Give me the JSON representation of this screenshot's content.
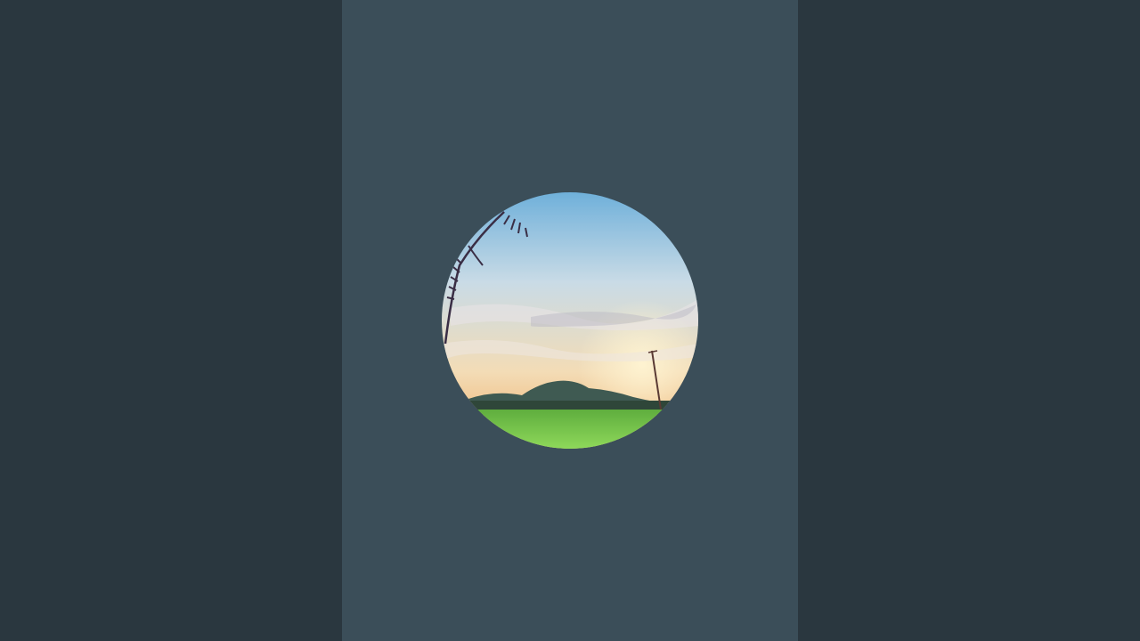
{
  "colors": {
    "side_background": "#2a373f",
    "center_background": "#3b4e59",
    "sky_top": "#6fb2dc",
    "sky_mid": "#cfdde6",
    "sky_horizon": "#f6d6a6",
    "field": "#7ccf4a",
    "hills": "#3f5a52"
  },
  "avatar": {
    "icon": "profile-photo-landscape"
  }
}
